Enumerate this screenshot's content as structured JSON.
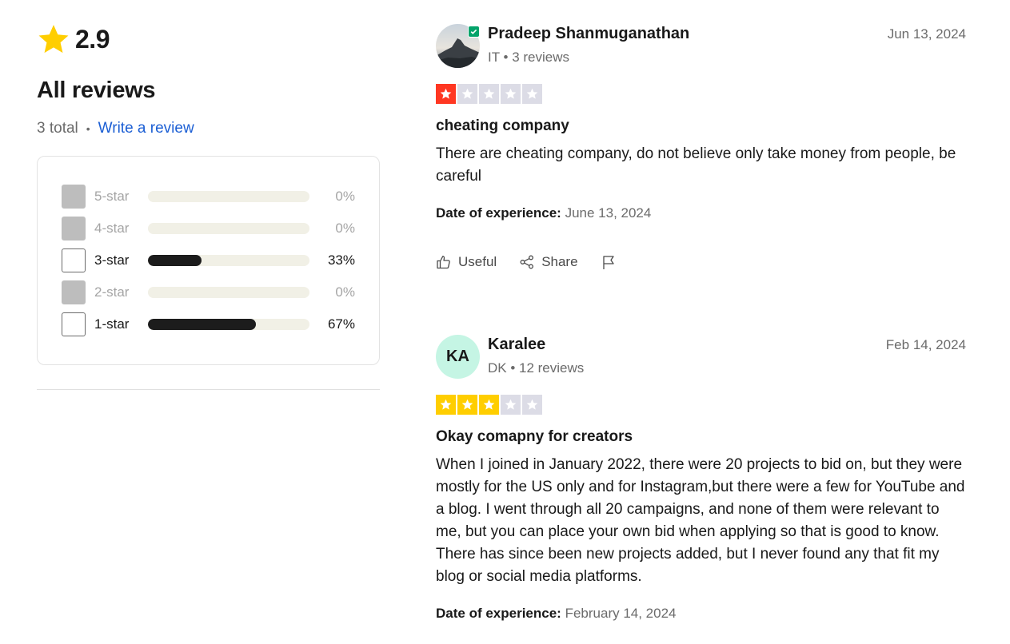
{
  "summary": {
    "rating": "2.9",
    "heading": "All reviews",
    "total": "3 total",
    "separator": "•",
    "write_review": "Write a review"
  },
  "distribution": [
    {
      "label": "5-star",
      "percent": "0%",
      "fraction": 0,
      "enabled": false
    },
    {
      "label": "4-star",
      "percent": "0%",
      "fraction": 0,
      "enabled": false
    },
    {
      "label": "3-star",
      "percent": "33%",
      "fraction": 0.33,
      "enabled": true
    },
    {
      "label": "2-star",
      "percent": "0%",
      "fraction": 0,
      "enabled": false
    },
    {
      "label": "1-star",
      "percent": "67%",
      "fraction": 0.67,
      "enabled": true
    }
  ],
  "reviews": [
    {
      "name": "Pradeep Shanmuganathan",
      "meta": "IT • 3 reviews",
      "date": "Jun 13, 2024",
      "stars": 1,
      "star_color": "#ff3722",
      "title": "cheating company",
      "body": "There are cheating company, do not believe only take money from people, be careful",
      "experience_label": "Date of experience:",
      "experience_date": "June 13, 2024",
      "useful": "Useful",
      "share": "Share"
    },
    {
      "name": "Karalee",
      "initials": "KA",
      "meta": "DK • 12 reviews",
      "date": "Feb 14, 2024",
      "stars": 3,
      "star_color": "#ffce00",
      "title": "Okay comapny for creators",
      "body": "When I joined in January 2022, there were 20 projects to bid on, but they were mostly for the US only and for Instagram,but there were a few for YouTube and a blog. I went through all 20 campaigns, and none of them were relevant to me, but you can place your own bid when applying so that is good to know. There has since been new projects added, but I never found any that fit my blog or social media platforms.",
      "experience_label": "Date of experience:",
      "experience_date": "February 14, 2024"
    }
  ],
  "colors": {
    "empty_star": "#dcdce6",
    "link": "#1c5fd4",
    "verified": "#04a36a"
  }
}
